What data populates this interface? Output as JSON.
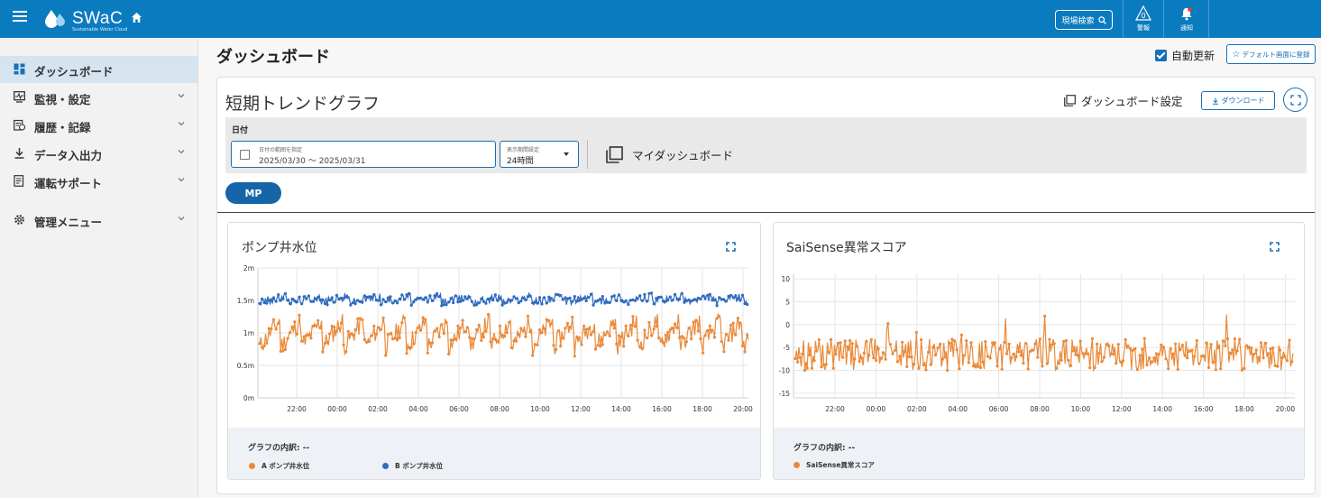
{
  "topbar": {
    "brand": "SWaC",
    "brand_sub": "Sustainable Water Cloud",
    "site_search": "現場検索",
    "alarm_label": "警報",
    "alarm_count": "0",
    "notify_label": "通知"
  },
  "sidebar": {
    "items": [
      {
        "label": "ダッシュボード",
        "icon": "dashboard-icon"
      },
      {
        "label": "監視・設定",
        "icon": "monitor-icon"
      },
      {
        "label": "履歴・記録",
        "icon": "history-icon"
      },
      {
        "label": "データ入出力",
        "icon": "download-icon"
      },
      {
        "label": "運転サポート",
        "icon": "support-icon"
      },
      {
        "label": "管理メニュー",
        "icon": "gear-icon"
      }
    ]
  },
  "page": {
    "title": "ダッシュボード",
    "auto_refresh": "自動更新",
    "default_screen": "デフォルト画面に登録"
  },
  "card": {
    "title": "短期トレンドグラフ",
    "dashboard_settings": "ダッシュボード設定",
    "download": "ダウンロード",
    "date_label": "日付",
    "date_placeholder": "日付の範囲を指定",
    "date_value": "2025/03/30 〜 2025/03/31",
    "period_placeholder": "表示期間設定",
    "period_value": "24時間",
    "my_dashboard": "マイダッシュボード",
    "mp_button": "MP"
  },
  "legend_title": "グラフの内訳:",
  "legend_value": "--",
  "colors": {
    "orange": "#ea8a3a",
    "blue": "#2f6bbf",
    "brand": "#0b7bbf"
  },
  "chart_data": [
    {
      "type": "line",
      "title": "ポンプ井水位",
      "yticks": [
        "0m",
        "0.5m",
        "1m",
        "1.5m",
        "2m"
      ],
      "ylim": [
        0,
        2
      ],
      "xticks": [
        "22:00",
        "00:00",
        "02:00",
        "04:00",
        "06:00",
        "08:00",
        "10:00",
        "12:00",
        "14:00",
        "16:00",
        "18:00",
        "20:00"
      ],
      "series": [
        {
          "name": "A ポンプ井水位",
          "color": "#ea8a3a",
          "range": [
            0.7,
            1.3
          ]
        },
        {
          "name": "B ポンプ井水位",
          "color": "#2f6bbf",
          "range": [
            1.35,
            1.6
          ]
        }
      ],
      "grid": true
    },
    {
      "type": "line",
      "title": "SaiSense異常スコア",
      "yticks": [
        "10",
        "5",
        "0",
        "-5",
        "-10",
        "-15"
      ],
      "ylim": [
        -16,
        11
      ],
      "xticks": [
        "22:00",
        "00:00",
        "02:00",
        "04:00",
        "06:00",
        "08:00",
        "10:00",
        "12:00",
        "14:00",
        "16:00",
        "18:00",
        "20:00"
      ],
      "series": [
        {
          "name": "SaiSense異常スコア",
          "color": "#ea8a3a",
          "range": [
            -10,
            -3
          ]
        }
      ],
      "grid": true
    }
  ]
}
